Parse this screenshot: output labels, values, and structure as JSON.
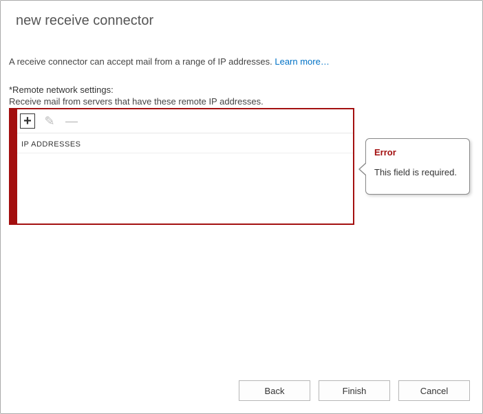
{
  "title": "new receive connector",
  "description_text": "A receive connector can accept mail from a range of IP addresses. ",
  "learn_more": "Learn more…",
  "field": {
    "label": "*Remote network settings:",
    "sub": "Receive mail from servers that have these remote IP addresses.",
    "column_header": "IP ADDRESSES"
  },
  "toolbar": {
    "add": "+",
    "edit": "✎",
    "remove": "—"
  },
  "error": {
    "title": "Error",
    "message": "This field is required."
  },
  "buttons": {
    "back": "Back",
    "finish": "Finish",
    "cancel": "Cancel"
  }
}
